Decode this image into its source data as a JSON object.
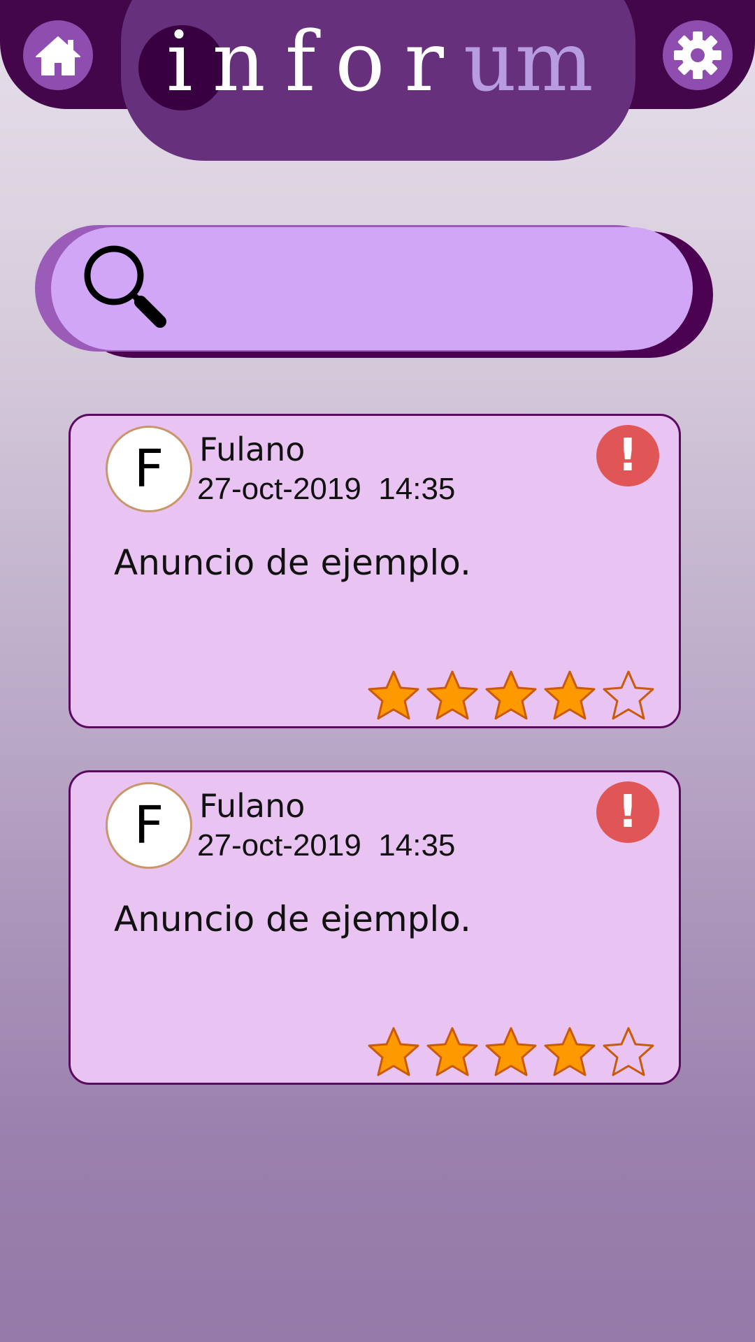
{
  "app": {
    "logo_main": "inforum",
    "logo_prefix": "infor",
    "logo_suffix": "um"
  },
  "search": {
    "value": "",
    "placeholder": ""
  },
  "colors": {
    "header_dark": "#43064a",
    "header_panel": "#67307c",
    "icon_button": "#8e4daf",
    "search_fill": "#d1a6f7",
    "card_fill": "#e9c3f1",
    "card_border": "#5a0a5f",
    "report": "#e05555",
    "star_fill": "#ff9900",
    "star_stroke": "#c85a0a"
  },
  "icons": {
    "home": "home-icon",
    "settings": "gear-icon",
    "search": "search-icon",
    "report": "exclamation-icon",
    "star": "star-icon"
  },
  "posts": [
    {
      "avatar_letter": "F",
      "author": "Fulano",
      "timestamp": "27-oct-2019  14:35",
      "text": "Anuncio de ejemplo.",
      "report_label": "!",
      "rating": 4,
      "rating_max": 5
    },
    {
      "avatar_letter": "F",
      "author": "Fulano",
      "timestamp": "27-oct-2019  14:35",
      "text": "Anuncio de ejemplo.",
      "report_label": "!",
      "rating": 4,
      "rating_max": 5
    }
  ]
}
